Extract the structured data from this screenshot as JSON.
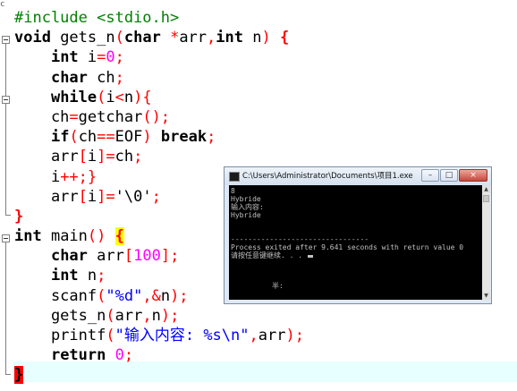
{
  "editor": {
    "corner_mark": "c",
    "lines": [
      [
        {
          "t": "#include <stdio.h>",
          "c": "pp"
        }
      ],
      [
        {
          "t": "void",
          "c": "kw"
        },
        {
          "t": " gets_n"
        },
        {
          "t": "(",
          "c": "rd"
        },
        {
          "t": "char",
          "c": "kw"
        },
        {
          "t": " "
        },
        {
          "t": "*",
          "c": "rd"
        },
        {
          "t": "arr"
        },
        {
          "t": ",",
          "c": "rd"
        },
        {
          "t": "int",
          "c": "kw"
        },
        {
          "t": " n"
        },
        {
          "t": ")",
          "c": "rd"
        },
        {
          "t": " "
        },
        {
          "t": "{",
          "c": "brace"
        }
      ],
      [
        {
          "t": "    "
        },
        {
          "t": "int",
          "c": "kw"
        },
        {
          "t": " i"
        },
        {
          "t": "=",
          "c": "rd"
        },
        {
          "t": "0",
          "c": "num"
        },
        {
          "t": ";",
          "c": "rd"
        }
      ],
      [
        {
          "t": "    "
        },
        {
          "t": "char",
          "c": "kw"
        },
        {
          "t": " ch"
        },
        {
          "t": ";",
          "c": "rd"
        }
      ],
      [
        {
          "t": "    "
        },
        {
          "t": "while",
          "c": "kw"
        },
        {
          "t": "(",
          "c": "rd"
        },
        {
          "t": "i"
        },
        {
          "t": "<",
          "c": "rd"
        },
        {
          "t": "n"
        },
        {
          "t": "){",
          "c": "rd"
        }
      ],
      [
        {
          "t": "    ch"
        },
        {
          "t": "=",
          "c": "rd"
        },
        {
          "t": "getchar"
        },
        {
          "t": "();",
          "c": "rd"
        }
      ],
      [
        {
          "t": "    "
        },
        {
          "t": "if",
          "c": "kw"
        },
        {
          "t": "(",
          "c": "rd"
        },
        {
          "t": "ch"
        },
        {
          "t": "==",
          "c": "rd"
        },
        {
          "t": "EOF"
        },
        {
          "t": ")",
          "c": "rd"
        },
        {
          "t": " "
        },
        {
          "t": "break",
          "c": "kw"
        },
        {
          "t": ";",
          "c": "rd"
        }
      ],
      [
        {
          "t": "    arr"
        },
        {
          "t": "[",
          "c": "rd"
        },
        {
          "t": "i"
        },
        {
          "t": "]=",
          "c": "rd"
        },
        {
          "t": "ch"
        },
        {
          "t": ";",
          "c": "rd"
        }
      ],
      [
        {
          "t": "    i"
        },
        {
          "t": "++;}",
          "c": "rd"
        }
      ],
      [
        {
          "t": "    arr"
        },
        {
          "t": "[",
          "c": "rd"
        },
        {
          "t": "i"
        },
        {
          "t": "]=",
          "c": "rd"
        },
        {
          "t": "'\\0'",
          "c": "chr"
        },
        {
          "t": ";",
          "c": "rd"
        }
      ],
      [
        {
          "t": "}",
          "c": "brace"
        }
      ],
      [
        {
          "t": "int",
          "c": "kw"
        },
        {
          "t": " main"
        },
        {
          "t": "()",
          "c": "rd"
        },
        {
          "t": " "
        },
        {
          "t": "{",
          "c": "bracehl"
        }
      ],
      [
        {
          "t": "    "
        },
        {
          "t": "char",
          "c": "kw"
        },
        {
          "t": " arr"
        },
        {
          "t": "[",
          "c": "rd"
        },
        {
          "t": "100",
          "c": "num"
        },
        {
          "t": "];",
          "c": "rd"
        }
      ],
      [
        {
          "t": "    "
        },
        {
          "t": "int",
          "c": "kw"
        },
        {
          "t": " n"
        },
        {
          "t": ";",
          "c": "rd"
        }
      ],
      [
        {
          "t": "    scanf"
        },
        {
          "t": "(",
          "c": "rd"
        },
        {
          "t": "\"%d\"",
          "c": "str"
        },
        {
          "t": ",&",
          "c": "rd"
        },
        {
          "t": "n"
        },
        {
          "t": ");",
          "c": "rd"
        }
      ],
      [
        {
          "t": "    gets_n"
        },
        {
          "t": "(",
          "c": "rd"
        },
        {
          "t": "arr"
        },
        {
          "t": ",",
          "c": "rd"
        },
        {
          "t": "n"
        },
        {
          "t": ");",
          "c": "rd"
        }
      ],
      [
        {
          "t": "    printf"
        },
        {
          "t": "(",
          "c": "rd"
        },
        {
          "t": "\"输入内容: %s\\n\"",
          "c": "str"
        },
        {
          "t": ",",
          "c": "rd"
        },
        {
          "t": "arr"
        },
        {
          "t": ");",
          "c": "rd"
        }
      ],
      [
        {
          "t": "    "
        },
        {
          "t": "return",
          "c": "kw"
        },
        {
          "t": " "
        },
        {
          "t": "0",
          "c": "num"
        },
        {
          "t": ";",
          "c": "rd"
        }
      ],
      [
        {
          "t": "}",
          "c": "bracered"
        }
      ]
    ]
  },
  "console": {
    "title": "C:\\Users\\Administrator\\Documents\\项目1.exe",
    "minimize": "–",
    "maximize": "□",
    "close": "×",
    "lines": [
      "8",
      "Hybride",
      "输入内容:",
      "Hybride",
      "",
      "--------------------------------",
      "Process exited after 9.641 seconds with return value 0",
      "请按任意键继续. . . "
    ],
    "ime_text": "半:"
  }
}
